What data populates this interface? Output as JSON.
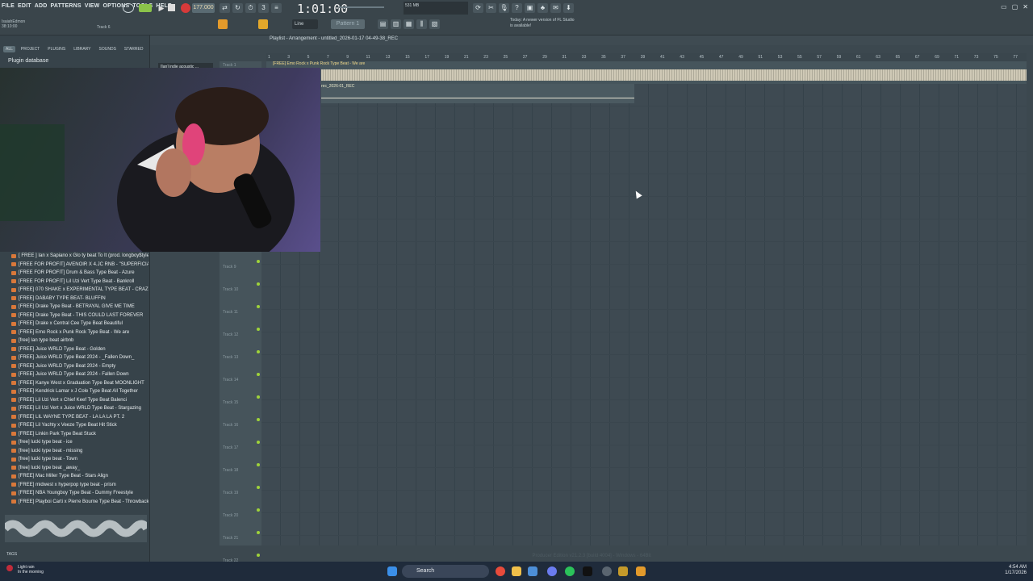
{
  "menu": [
    "FILE",
    "EDIT",
    "ADD",
    "PATTERNS",
    "VIEW",
    "OPTIONS",
    "TOOLS",
    "HELP"
  ],
  "transport": {
    "tempo": "177.000",
    "time": "1:01:00",
    "pattern": "Pattern 1",
    "snap": "Line",
    "memory": "531 MB"
  },
  "hint": {
    "user": "IsaiahEdmon",
    "time": "38:10:00",
    "track": "Track 6"
  },
  "notice": "Today: A newer version of FL Studio is available!",
  "browser": {
    "tabs": [
      "ALL",
      "PROJECT",
      "PLUGINS",
      "LIBRARY",
      "SOUNDS",
      "STARRED"
    ],
    "title": "Plugin database",
    "files": [
      "[ FREE ] Ian x Sapiano x Glo ty beat To It (prod. longboy$tyle)",
      "[FREE FOR PROFIT] AVENOIR X 4.JC RNB - \"SUPERFICIAL LUV\"",
      "[FREE FOR PROFIT] Drum & Bass Type Beat - Azure",
      "[FREE FOR PROFIT] Lil Uzi Vert Type Beat - Bankroll",
      "[FREE] 070 SHAKE x EXPERIMENTAL TYPE BEAT - CRAZE",
      "[FREE] DABABY TYPE BEAT- BLUFFIN",
      "[FREE] Drake Type Beat - BETRAYAL  GIVE ME TIME",
      "[FREE] Drake Type Beat - THIS COULD LAST FOREVER",
      "[FREE] Drake x Central Cee Type Beat Beautiful",
      "[FREE] Emo Rock x Punk Rock Type Beat - We are",
      "[free] Ian type beat airbnb",
      "[FREE] Juice WRLD Type Beat - Golden",
      "[FREE] Juice WRLD Type Beat 2024 - _Fallen Down_",
      "[FREE] Juice WRLD Type Beat 2024 - Empty",
      "[FREE] Juice WRLD Type Beat 2024 - Fallen Down",
      "[FREE] Kanye West x Graduation Type Beat MOONLIGHT",
      "[FREE] Kendrick Lamar x J Cole Type Beat  All Together",
      "[FREE] Lil Uzi Vert x Chief Keef Type Beat Balenci",
      "[FREE] Lil Uzi Vert x Juice WRLD Type Beat - Stargazing",
      "[FREE] LIL WAYNE TYPE BEAT - LA LA LA PT. 2",
      "[FREE] Lil Yachty x Veeze Type Beat Hit Stick",
      "[FREE] Linkin Park Type Beat  Stuck",
      "[free] lucki type beat - ice",
      "[free] lucki type beat - missing",
      "[free] lucki type beat - Town",
      "[free] lucki type beat _away_",
      "[FREE] Mac Miller Type Beat - Stars Align",
      "[FREE] midwest x hyperpop type beat - prism",
      "[FREE] NBA Youngboy Type Beat - Dummy Freestyle",
      "[FREE] Playboi Carti x Pierre Bourne Type Beat - Throwback"
    ],
    "tags_label": "TAGS"
  },
  "playlist": {
    "title": "Playlist - Arrangement - untitled_2026-01-17 04-49-38_REC",
    "pattern_picker": "[Ian] indie acoustic ...",
    "clip1_label": "[FREE] Emo Rock x Punk Rock Type Beat - We are",
    "clip2_label": "rec_2026-01_REC",
    "track1": "Track 1",
    "ruler": [
      "1",
      "3",
      "5",
      "7",
      "9",
      "11",
      "13",
      "15",
      "17",
      "19",
      "21",
      "23",
      "25",
      "27",
      "29",
      "31",
      "33",
      "35",
      "37",
      "39",
      "41",
      "43",
      "45",
      "47",
      "49",
      "51",
      "53",
      "55",
      "57",
      "59",
      "61",
      "63",
      "65",
      "67",
      "69",
      "71",
      "73",
      "75",
      "77"
    ],
    "tracks": [
      "Track 9",
      "Track 10",
      "Track 11",
      "Track 12",
      "Track 13",
      "Track 14",
      "Track 15",
      "Track 16",
      "Track 17",
      "Track 18",
      "Track 19",
      "Track 20",
      "Track 21",
      "Track 22"
    ]
  },
  "status": "Producer Edition v21.2.3 [build 4004] - Windows - 64Bit",
  "taskbar": {
    "weather": "Light rain",
    "weather_sub": "In the morning",
    "search": "Search",
    "time": "4:54 AM",
    "date": "1/17/2026"
  },
  "colors": {
    "accent": "#9fd33a",
    "record": "#d63a3a",
    "clip_wave": "#ded6c0",
    "file_icon": "#d9783a"
  }
}
